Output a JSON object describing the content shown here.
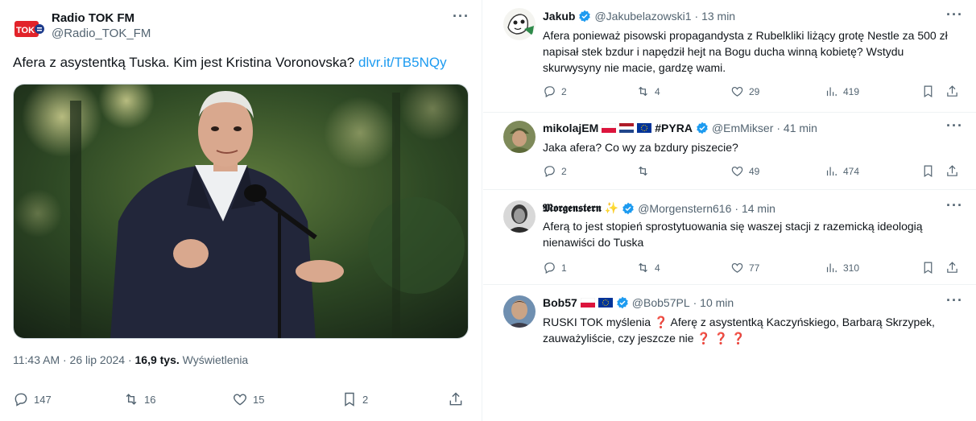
{
  "main_tweet": {
    "author_name": "Radio TOK FM",
    "author_handle": "@Radio_TOK_FM",
    "avatar_text": "TOK",
    "text": "Afera z asystentką Tuska. Kim jest Kristina Voronovska?",
    "link": "dlvr.it/TB5NQy",
    "time": "11:43 AM · 26 lip 2024 · ",
    "views_count": "16,9 tys.",
    "views_label": " Wyświetlenia",
    "replies": "147",
    "reposts": "16",
    "likes": "15",
    "bookmarks": "2"
  },
  "replies": [
    {
      "name": "Jakub",
      "handle": "@Jakubelazowski1",
      "time": "· 13 min",
      "text": "Afera ponieważ pisowski propagandysta z Rubelkliki liżący grotę Nestle za 500 zł napisał stek bzdur i napędził hejt na Bogu ducha winną kobietę? Wstydu skurwysyny nie macie, gardzę wami.",
      "replies": "2",
      "reposts": "4",
      "likes": "29",
      "views": "419"
    },
    {
      "name": "mikolajEM",
      "name_suffix": "#PYRA",
      "handle": "@EmMikser",
      "time": "· 41 min",
      "text": "Jaka afera? Co wy za bzdury piszecie?",
      "replies": "2",
      "reposts": "",
      "likes": "49",
      "views": "474"
    },
    {
      "name": "𝕸𝖔𝖗𝖌𝖊𝖓𝖘𝖙𝖊𝖗𝖓",
      "name_suffix": "✨",
      "handle": "@Morgenstern616",
      "time": "· 14 min",
      "text": "Aferą to jest stopień sprostytuowania się waszej stacji z razemicką ideologią nienawiści do Tuska",
      "replies": "1",
      "reposts": "4",
      "likes": "77",
      "views": "310"
    },
    {
      "name": "Bob57",
      "handle": "@Bob57PL",
      "time": "· 10 min",
      "text_a": "RUSKI TOK myślenia ",
      "text_b": " Aferę z asystentką Kaczyńskiego, Barbarą Skrzypek, zauważyliście, czy jeszcze nie ",
      "qmark": "❓",
      "qmarks": "❓ ❓ ❓"
    }
  ],
  "colors": {
    "accent": "#1d9bf0",
    "text": "#0f1419",
    "muted": "#536471",
    "border": "#eff3f4"
  }
}
